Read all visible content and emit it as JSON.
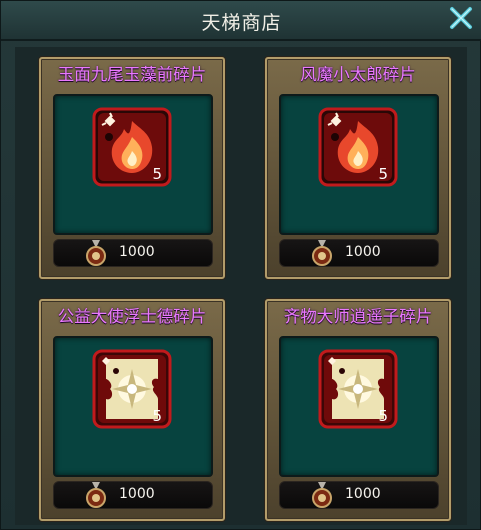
{
  "window": {
    "title": "天梯商店"
  },
  "items": [
    {
      "name": "玉面九尾玉藻前碎片",
      "count": "5",
      "price": "1000",
      "icon": "fire-shard-icon"
    },
    {
      "name": "风魔小太郎碎片",
      "count": "5",
      "price": "1000",
      "icon": "fire-shard-icon"
    },
    {
      "name": "公益大使浮士德碎片",
      "count": "5",
      "price": "1000",
      "icon": "light-shard-icon"
    },
    {
      "name": "齐物大师逍遥子碎片",
      "count": "5",
      "price": "1000",
      "icon": "light-shard-icon"
    }
  ],
  "colors": {
    "name": "#ea78ff",
    "well": "#07433f",
    "frame": "#b29c6a"
  }
}
